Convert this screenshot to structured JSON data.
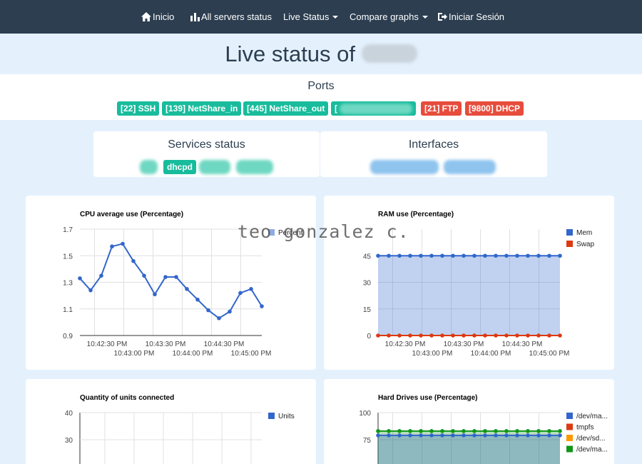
{
  "nav": {
    "home": "Inicio",
    "all_servers": "All servers status",
    "live_status": "Live Status",
    "compare": "Compare graphs",
    "login": "Iniciar Sesión"
  },
  "page_title": "Live status of",
  "ports": {
    "title": "Ports",
    "items": [
      "[22] SSH",
      "[139] NetShare_in",
      "[445] NetShare_out",
      "[",
      "[21] FTP",
      "[9800] DHCP"
    ]
  },
  "services": {
    "title": "Services status",
    "items": [
      "dhcpd"
    ]
  },
  "interfaces": {
    "title": "Interfaces"
  },
  "watermark": "teo gonzalez c.",
  "colors": {
    "nav_bg": "#2c3e50",
    "teal": "#18bc9c",
    "red": "#e74c3c",
    "page_bg": "#e4f1fd"
  },
  "chart_data": [
    {
      "type": "line",
      "title": "CPU average use (Percentage)",
      "xticks_top": [
        "10:42:30 PM",
        "10:43:30 PM",
        "10:44:30 PM"
      ],
      "xticks_bottom": [
        "10:43:00 PM",
        "10:44:00 PM",
        "10:45:00 PM"
      ],
      "yticks": [
        "1.7",
        "1.5",
        "1.3",
        "1.1",
        "0.9"
      ],
      "ylim": [
        0.9,
        1.7
      ],
      "series": [
        {
          "name": "Percent",
          "color": "#3366cc",
          "values": [
            1.33,
            1.24,
            1.35,
            1.57,
            1.59,
            1.46,
            1.35,
            1.21,
            1.34,
            1.34,
            1.25,
            1.17,
            1.09,
            1.03,
            1.08,
            1.22,
            1.25,
            1.12
          ]
        }
      ]
    },
    {
      "type": "area",
      "title": "RAM use (Percentage)",
      "xticks_top": [
        "10:42:30 PM",
        "10:43:30 PM",
        "10:44:30 PM"
      ],
      "xticks_bottom": [
        "10:43:00 PM",
        "10:44:00 PM",
        "10:45:00 PM"
      ],
      "yticks": [
        "45",
        "30",
        "15",
        "0"
      ],
      "ylim": [
        0,
        60
      ],
      "series": [
        {
          "name": "Mem",
          "color": "#3366cc",
          "values": [
            45,
            45,
            45,
            45,
            45,
            45,
            45,
            45,
            45,
            45,
            45,
            45,
            45,
            45,
            45,
            45,
            45,
            45
          ]
        },
        {
          "name": "Swap",
          "color": "#dc3912",
          "values": [
            0,
            0,
            0,
            0,
            0,
            0,
            0,
            0,
            0,
            0,
            0,
            0,
            0,
            0,
            0,
            0,
            0,
            0
          ]
        }
      ]
    },
    {
      "type": "line",
      "title": "Quantity of units connected",
      "yticks": [
        "40",
        "30"
      ],
      "series": [
        {
          "name": "Units",
          "color": "#3366cc",
          "values": []
        }
      ]
    },
    {
      "type": "area",
      "title": "Hard Drives use (Percentage)",
      "yticks": [
        "100",
        "75"
      ],
      "ylim": [
        0,
        100
      ],
      "series": [
        {
          "name": "/dev/ma...",
          "color": "#3366cc",
          "values": [
            79,
            79,
            79,
            79,
            79,
            79,
            79,
            79,
            79,
            79,
            79,
            79,
            79,
            79,
            79,
            79,
            79,
            79
          ]
        },
        {
          "name": "tmpfs",
          "color": "#dc3912",
          "values": []
        },
        {
          "name": "/dev/sd...",
          "color": "#ff9900",
          "values": []
        },
        {
          "name": "/dev/ma...",
          "color": "#109618",
          "values": [
            83,
            83,
            83,
            83,
            83,
            83,
            83,
            83,
            83,
            83,
            83,
            83,
            83,
            83,
            83,
            83,
            83,
            83
          ]
        }
      ]
    }
  ]
}
